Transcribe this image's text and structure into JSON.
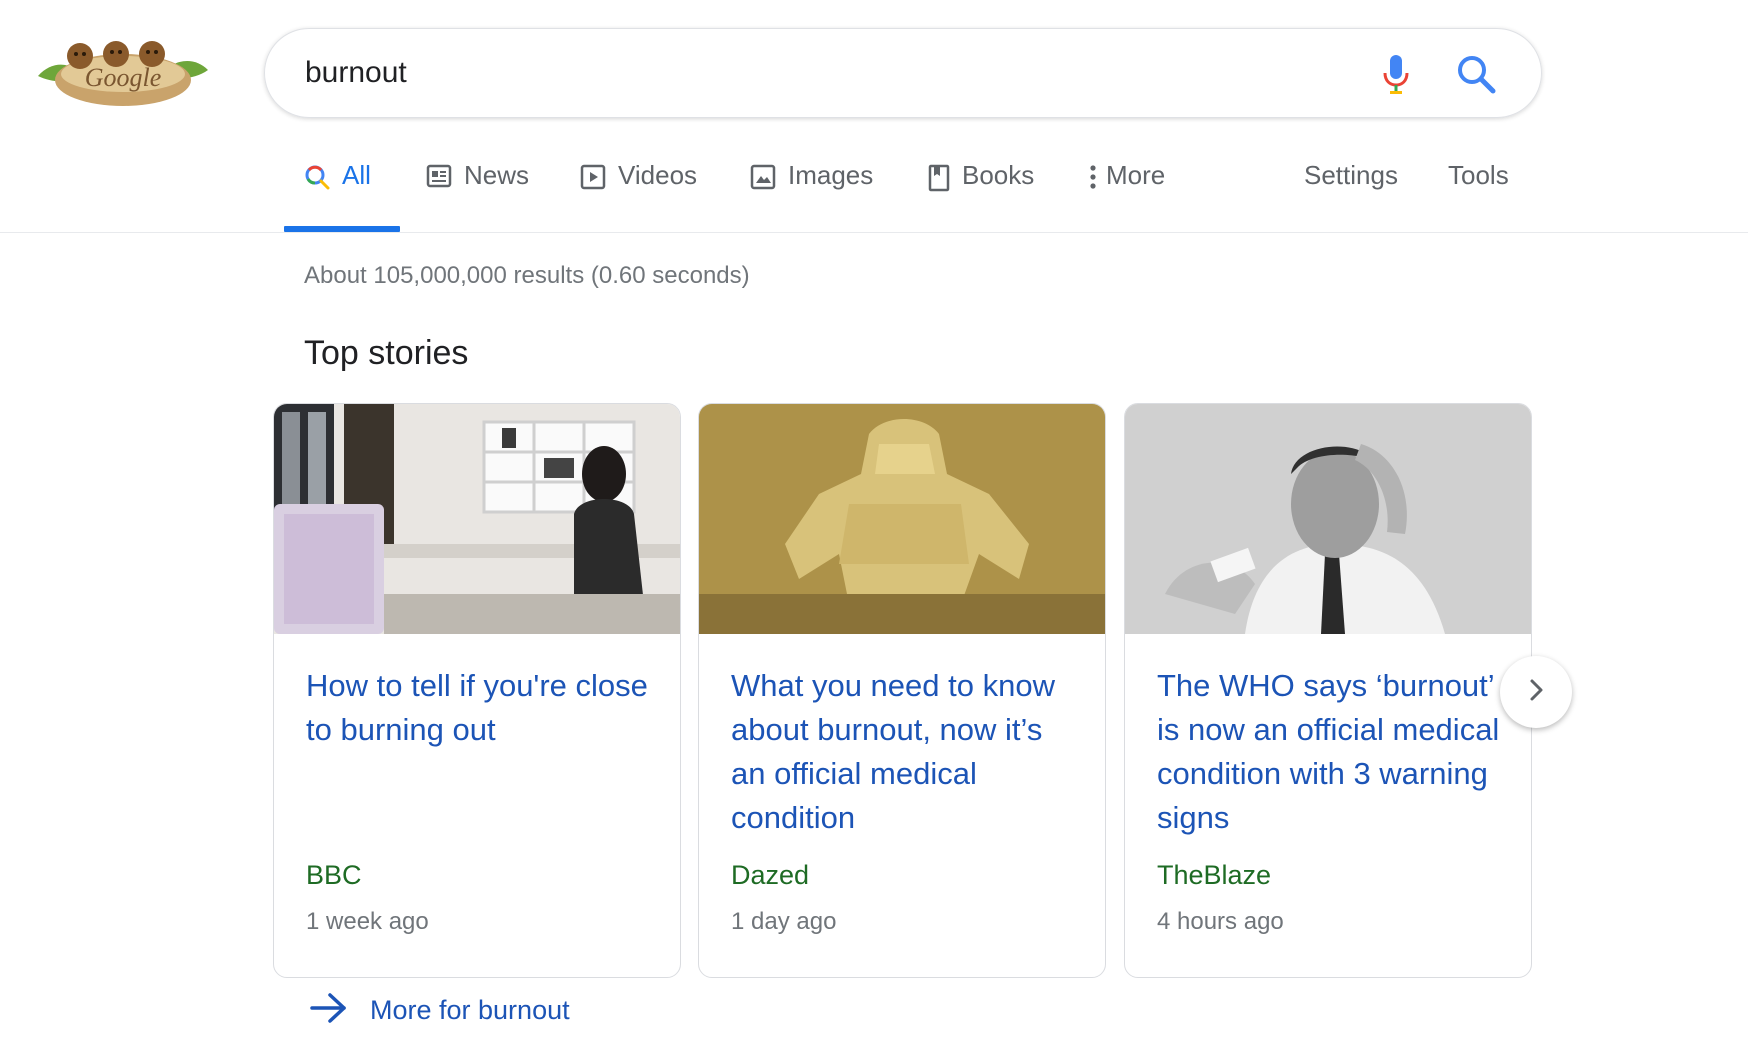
{
  "logo": {
    "text": "Google"
  },
  "search": {
    "query": "burnout"
  },
  "tabs": [
    {
      "label": "All",
      "icon": "search-icon"
    },
    {
      "label": "News",
      "icon": "news-icon"
    },
    {
      "label": "Videos",
      "icon": "video-icon"
    },
    {
      "label": "Images",
      "icon": "image-icon"
    },
    {
      "label": "Books",
      "icon": "book-icon"
    },
    {
      "label": "More",
      "icon": "more-vert-icon"
    }
  ],
  "tools": {
    "settings": "Settings",
    "tools": "Tools"
  },
  "result_stats": "About 105,000,000 results (0.60 seconds)",
  "top_stories": {
    "title": "Top stories",
    "cards": [
      {
        "title": "How to tell if you're close to burning out",
        "source": "BBC",
        "time": "1 week ago"
      },
      {
        "title": "What you need to know about burnout, now it’s an official medical condition",
        "source": "Dazed",
        "time": "1 day ago"
      },
      {
        "title": "The WHO says ‘burnout’ is now an official medical condition with 3 warning signs",
        "source": "TheBlaze",
        "time": "4 hours ago"
      }
    ],
    "more_link": "More for burnout"
  },
  "colors": {
    "link": "#1c54b6",
    "source": "#1e6b24",
    "accent": "#1a73e8",
    "muted": "#70757a"
  }
}
